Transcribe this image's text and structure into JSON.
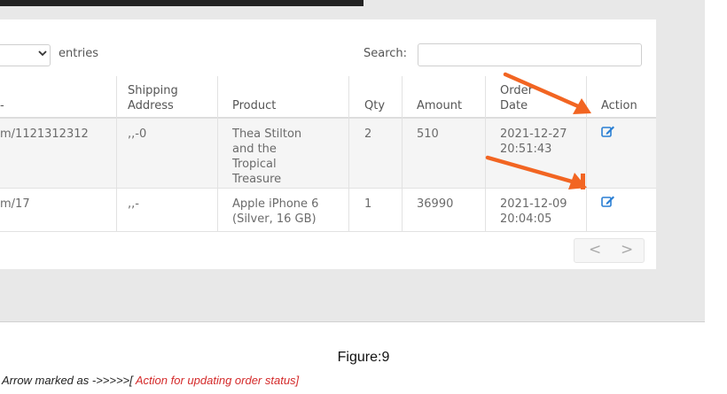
{
  "controls": {
    "entries_label": "entries",
    "search_label": "Search:",
    "search_value": ""
  },
  "table": {
    "columns": {
      "shipping_address": [
        "Shipping",
        "Address"
      ],
      "product": "Product",
      "qty": "Qty",
      "amount": "Amount",
      "order_date": [
        "Order",
        "Date"
      ],
      "action": "Action"
    },
    "rows": [
      {
        "col1": "m/1121312312",
        "shipping_address": ",,-0",
        "product": [
          "Thea Stilton",
          "and the",
          "Tropical",
          "Treasure"
        ],
        "qty": "2",
        "amount": "510",
        "order_date": [
          "2021-12-27",
          "20:51:43"
        ],
        "action_icon": "edit-icon"
      },
      {
        "col1": "m/17",
        "shipping_address": ",,-",
        "product": [
          "Apple iPhone 6",
          "(Silver, 16 GB)"
        ],
        "qty": "1",
        "amount": "36990",
        "order_date": [
          "2021-12-09",
          "20:04:05"
        ],
        "action_icon": "edit-icon"
      }
    ]
  },
  "pagination": {
    "prev": "<",
    "next": ">"
  },
  "caption": {
    "figure": "Figure:9",
    "note_prefix": "Arrow marked as ->>>>>[ ",
    "note_red": "Action for updating order status]"
  },
  "colors": {
    "arrow": "#f26522",
    "edit_icon": "#2a7fd4",
    "note_red": "#d42a2a"
  }
}
